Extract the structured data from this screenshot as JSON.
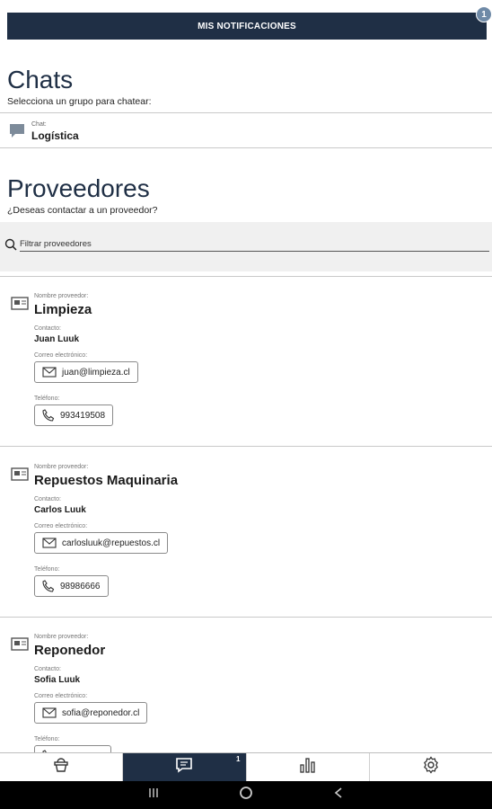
{
  "notifications": {
    "label": "MIS NOTIFICACIONES",
    "badge": "1"
  },
  "chats": {
    "title": "Chats",
    "subtitle": "Selecciona un grupo para chatear:",
    "items": [
      {
        "small_label": "Chat:",
        "name": "Logística"
      }
    ]
  },
  "proveedores": {
    "title": "Proveedores",
    "subtitle": "¿Deseas contactar a un proveedor?",
    "search_placeholder": "Filtrar proveedores",
    "labels": {
      "name": "Nombre proveedor:",
      "contact": "Contacto:",
      "email": "Correo electrónico:",
      "phone": "Teléfono:"
    },
    "items": [
      {
        "name": "Limpieza",
        "contact": "Juan Luuk",
        "email": "juan@limpieza.cl",
        "phone": "993419508"
      },
      {
        "name": "Repuestos Maquinaria",
        "contact": "Carlos Luuk",
        "email": "carlosluuk@repuestos.cl",
        "phone": "98986666"
      },
      {
        "name": "Reponedor",
        "contact": "Sofia Luuk",
        "email": "sofia@reponedor.cl",
        "phone": ""
      }
    ]
  },
  "bottom_nav": {
    "items": [
      {
        "icon": "basket-icon",
        "active": false,
        "badge": ""
      },
      {
        "icon": "chat-icon",
        "active": true,
        "badge": "1"
      },
      {
        "icon": "bar-chart-icon",
        "active": false,
        "badge": ""
      },
      {
        "icon": "gear-icon",
        "active": false,
        "badge": ""
      }
    ]
  },
  "system_nav": {
    "icons": [
      "recents-icon",
      "home-icon",
      "back-icon"
    ]
  },
  "colors": {
    "primary": "#1f2f45",
    "badge": "#6f8aa7",
    "search_bg": "#f0f0f0"
  }
}
